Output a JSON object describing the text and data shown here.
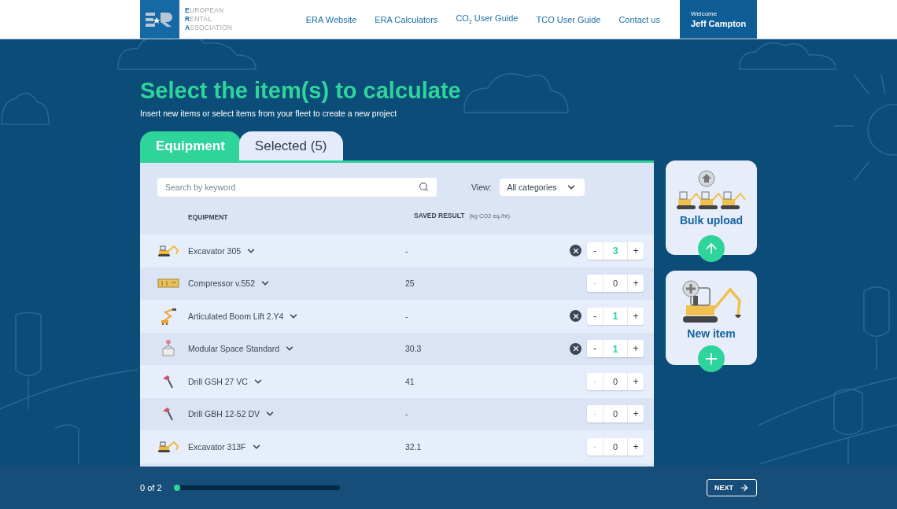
{
  "header": {
    "logo_lines": [
      "**E**UROPEAN",
      "**R**ENTAL",
      "**A**SSOCIATION"
    ],
    "nav": [
      "ERA Website",
      "ERA Calculators",
      "CO$_{2}$ User Guide",
      "TCO User Guide",
      "Contact us"
    ],
    "user": {
      "greeting": "Welcome",
      "name": "Jeff Campton"
    }
  },
  "title": "Select the item(s) to calculate",
  "subtitle": "Insert new items or select items from your fleet to create a new project",
  "tabs": [
    {
      "label": "Equipment",
      "selected": true
    },
    {
      "label": "Selected (5)",
      "selected": false
    }
  ],
  "search": {
    "placeholder": "Search by keyword"
  },
  "view": {
    "label": "View:",
    "value": "All categories"
  },
  "columns": {
    "equipment": "EQUIPMENT",
    "result": "SAVED RESULT",
    "unit": "(kg CO2 eq./hr)"
  },
  "rows": [
    {
      "kind": "excavator",
      "name": "Excavator 305",
      "result": "-",
      "selected": true,
      "quantity": "3"
    },
    {
      "kind": "compressor",
      "name": "Compressor v.552",
      "result": "25",
      "selected": false,
      "quantity": "0"
    },
    {
      "kind": "boom-lift",
      "name": "Articulated Boom Lift 2.Y4",
      "result": "-",
      "selected": true,
      "quantity": "1"
    },
    {
      "kind": "modular",
      "name": "Modular Space Standard",
      "result": "30.3",
      "selected": true,
      "quantity": "1"
    },
    {
      "kind": "drill",
      "name": "Drill GSH 27 VC",
      "result": "41",
      "selected": false,
      "quantity": "0"
    },
    {
      "kind": "drill",
      "name": "Drill GBH 12-52 DV",
      "result": "-",
      "selected": false,
      "quantity": "0"
    },
    {
      "kind": "excavator",
      "name": "Excavator 313F",
      "result": "32.1",
      "selected": false,
      "quantity": "0"
    }
  ],
  "stepper": {
    "minus": "-",
    "plus": "+"
  },
  "cards": [
    {
      "kind": "bulk",
      "label": "Bulk upload"
    },
    {
      "kind": "new",
      "label": "New item"
    }
  ],
  "footer": {
    "step": "0 of 2",
    "progress": {
      "level": 0
    },
    "next": "NEXT"
  }
}
